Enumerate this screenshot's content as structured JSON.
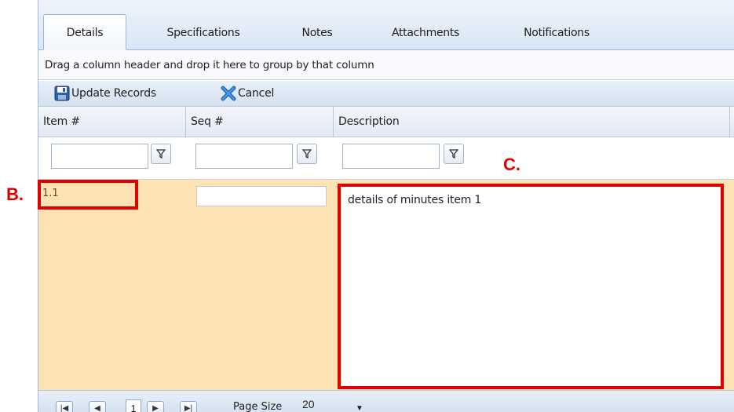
{
  "tabs": [
    {
      "label": "Details",
      "active": true
    },
    {
      "label": "Specifications",
      "active": false
    },
    {
      "label": "Notes",
      "active": false
    },
    {
      "label": "Attachments",
      "active": false
    },
    {
      "label": "Notifications",
      "active": false
    }
  ],
  "grouping": {
    "text": "Drag a column header and drop it here to group by that column"
  },
  "toolbar": {
    "update": {
      "label": "Update Records",
      "icon": "save-icon"
    },
    "cancel": {
      "label": "Cancel",
      "icon": "close-icon"
    }
  },
  "columns": [
    {
      "label": "Item #"
    },
    {
      "label": "Seq #"
    },
    {
      "label": "Description"
    }
  ],
  "row": {
    "item": "1.1",
    "seq": "",
    "description": "details of minutes item 1"
  },
  "pager": {
    "current_page": "1",
    "page_size_label": "Page Size",
    "page_size": "20"
  },
  "annotations": {
    "b": "B.",
    "c": "C.",
    "color": "#e00000"
  },
  "colors": {
    "row_highlight": "#fde3b3",
    "header_bg": "#dde7f3"
  }
}
